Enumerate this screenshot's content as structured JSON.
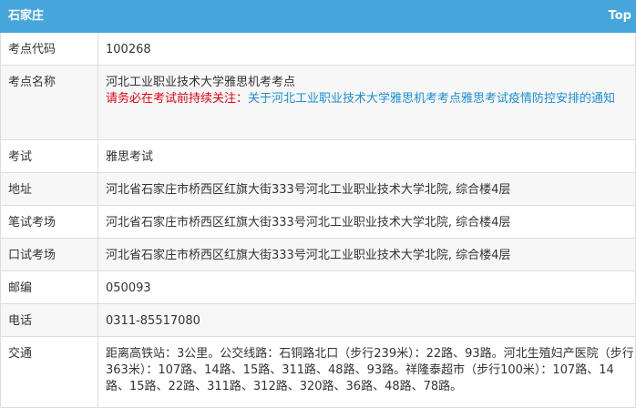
{
  "header": {
    "city": "石家庄",
    "top_link": "Top"
  },
  "rows": {
    "code": {
      "label": "考点代码",
      "value": "100268"
    },
    "name": {
      "label": "考点名称",
      "value": "河北工业职业技术大学雅思机考考点",
      "warning": "请务必在考试前持续关注：",
      "notice_link": "关于河北工业职业技术大学雅思机考考点雅思考试疫情防控安排的通知"
    },
    "exam": {
      "label": "考试",
      "value": "雅思考试"
    },
    "address": {
      "label": "地址",
      "value": "河北省石家庄市桥西区红旗大街333号河北工业职业技术大学北院, 综合楼4层"
    },
    "written": {
      "label": "笔试考场",
      "value": "河北省石家庄市桥西区红旗大街333号河北工业职业技术大学北院, 综合楼4层"
    },
    "oral": {
      "label": "口试考场",
      "value": "河北省石家庄市桥西区红旗大街333号河北工业职业技术大学北院, 综合楼4层"
    },
    "postcode": {
      "label": "邮编",
      "value": "050093"
    },
    "phone": {
      "label": "电话",
      "value": "0311-85517080"
    },
    "transport": {
      "label": "交通",
      "value": "距离高铁站：3公里。公交线路：石铜路北口（步行239米）：22路、93路。河北生殖妇产医院（步行363米）：107路、14路、15路、311路、48路、93路。祥隆泰超市（步行100米）：107路、14路、15路、22路、311路、312路、320路、36路、48路、78路。"
    }
  }
}
